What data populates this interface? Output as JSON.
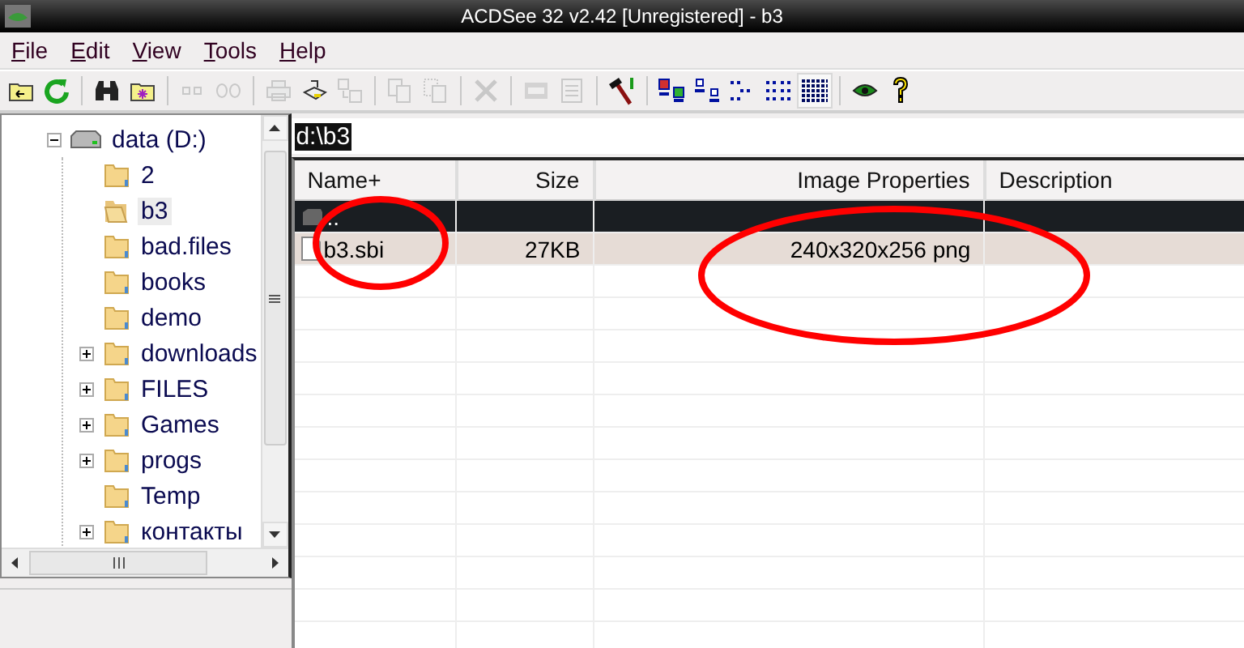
{
  "window": {
    "title": "ACDSee 32 v2.42 [Unregistered] - b3"
  },
  "menu": [
    "File",
    "Edit",
    "View",
    "Tools",
    "Help"
  ],
  "toolbar": [
    {
      "kind": "up-folder",
      "disabled": false,
      "pressed": false
    },
    {
      "kind": "refresh",
      "disabled": false,
      "pressed": false
    },
    {
      "kind": "separator"
    },
    {
      "kind": "binoculars",
      "disabled": false,
      "pressed": false
    },
    {
      "kind": "new-folder",
      "disabled": false,
      "pressed": false
    },
    {
      "kind": "separator"
    },
    {
      "kind": "squares",
      "disabled": true,
      "pressed": false
    },
    {
      "kind": "rings",
      "disabled": true,
      "pressed": false
    },
    {
      "kind": "separator"
    },
    {
      "kind": "printer",
      "disabled": true,
      "pressed": false
    },
    {
      "kind": "scanner",
      "disabled": false,
      "pressed": false
    },
    {
      "kind": "move",
      "disabled": true,
      "pressed": false
    },
    {
      "kind": "separator"
    },
    {
      "kind": "copy",
      "disabled": true,
      "pressed": false
    },
    {
      "kind": "paste",
      "disabled": true,
      "pressed": false
    },
    {
      "kind": "separator"
    },
    {
      "kind": "delete",
      "disabled": true,
      "pressed": false
    },
    {
      "kind": "separator"
    },
    {
      "kind": "rename",
      "disabled": true,
      "pressed": false
    },
    {
      "kind": "properties",
      "disabled": true,
      "pressed": false
    },
    {
      "kind": "separator"
    },
    {
      "kind": "hammer",
      "disabled": false,
      "pressed": false
    },
    {
      "kind": "separator"
    },
    {
      "kind": "large-icons",
      "disabled": false,
      "pressed": false
    },
    {
      "kind": "small-icons",
      "disabled": false,
      "pressed": false
    },
    {
      "kind": "list",
      "disabled": false,
      "pressed": false
    },
    {
      "kind": "thumbnails",
      "disabled": false,
      "pressed": false
    },
    {
      "kind": "details",
      "disabled": false,
      "pressed": true
    },
    {
      "kind": "separator"
    },
    {
      "kind": "eye",
      "disabled": false,
      "pressed": false
    },
    {
      "kind": "help",
      "disabled": false,
      "pressed": false
    }
  ],
  "tree": [
    {
      "label": "data (D:)",
      "kind": "drive",
      "expanded": true,
      "selected": false,
      "children": [
        {
          "label": "2",
          "expandable": false,
          "selected": false
        },
        {
          "label": "b3",
          "expandable": false,
          "selected": true
        },
        {
          "label": "bad.files",
          "expandable": false,
          "selected": false
        },
        {
          "label": "books",
          "expandable": false,
          "selected": false
        },
        {
          "label": "demo",
          "expandable": false,
          "selected": false
        },
        {
          "label": "downloads",
          "expandable": true,
          "selected": false
        },
        {
          "label": "FILES",
          "expandable": true,
          "selected": false
        },
        {
          "label": "Games",
          "expandable": true,
          "selected": false
        },
        {
          "label": "progs",
          "expandable": true,
          "selected": false
        },
        {
          "label": "Temp",
          "expandable": false,
          "selected": false
        },
        {
          "label": "контакты",
          "expandable": true,
          "selected": false
        }
      ]
    }
  ],
  "address": {
    "value": "d:\\b3"
  },
  "table": {
    "columns": [
      {
        "label": "Name+"
      },
      {
        "label": "Size"
      },
      {
        "label": "Image Properties"
      },
      {
        "label": "Description"
      }
    ],
    "rows": [
      {
        "kind": "parent",
        "cells": [
          "..",
          "",
          "",
          ""
        ],
        "selected": true,
        "highlighted": false
      },
      {
        "kind": "file",
        "cells": [
          "b3.sbi",
          "27KB",
          "240x320x256 png",
          ""
        ],
        "selected": false,
        "highlighted": true
      }
    ]
  },
  "annotation_marks": [
    {
      "kind": "ellipse"
    },
    {
      "kind": "ellipse"
    }
  ]
}
